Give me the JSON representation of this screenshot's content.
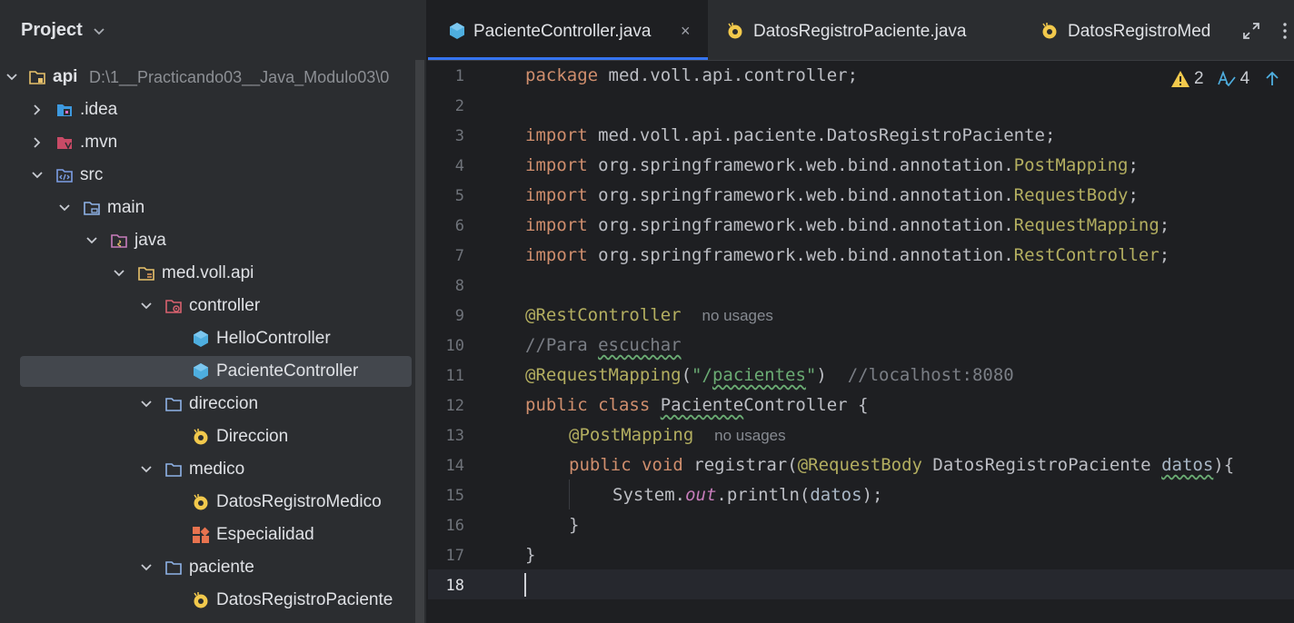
{
  "project_panel": {
    "title": "Project",
    "tree": [
      {
        "label": "api",
        "path": "D:\\1__Practicando03__Java_Modulo03\\0"
      },
      {
        "label": ".idea"
      },
      {
        "label": ".mvn"
      },
      {
        "label": "src"
      },
      {
        "label": "main"
      },
      {
        "label": "java"
      },
      {
        "label": "med.voll.api"
      },
      {
        "label": "controller"
      },
      {
        "label": "HelloController"
      },
      {
        "label": "PacienteController"
      },
      {
        "label": "direccion"
      },
      {
        "label": "Direccion"
      },
      {
        "label": "medico"
      },
      {
        "label": "DatosRegistroMedico"
      },
      {
        "label": "Especialidad"
      },
      {
        "label": "paciente"
      },
      {
        "label": "DatosRegistroPaciente"
      }
    ]
  },
  "editor": {
    "tabs": [
      {
        "label": "PacienteController.java",
        "close": "×"
      },
      {
        "label": "DatosRegistroPaciente.java"
      },
      {
        "label": "DatosRegistroMed"
      }
    ],
    "inspections": {
      "warnings": "2",
      "typos": "4"
    },
    "line_numbers": [
      "1",
      "2",
      "3",
      "4",
      "5",
      "6",
      "7",
      "8",
      "9",
      "10",
      "11",
      "12",
      "13",
      "14",
      "15",
      "16",
      "17",
      "18"
    ],
    "code": {
      "l1_kw": "package",
      "l1_rest": " med.voll.api.controller;",
      "import_kw": "import",
      "l3_rest": " med.voll.api.paciente.DatosRegistroPaciente;",
      "pkg_annotation": " org.springframework.web.bind.annotation.",
      "l4_cls": "PostMapping",
      "l5_cls": "RequestBody",
      "l6_cls": "RequestMapping",
      "l7_cls": "RestController",
      "semicolon": ";",
      "l9_ann": "@RestController",
      "no_usages": "no usages",
      "l10_cmt_a": "//Para ",
      "l10_cmt_b": "escuchar",
      "l11_ann": "@RequestMapping",
      "l11_open": "(",
      "l11_str_a": "\"/",
      "l11_str_b": "pacientes",
      "l11_str_c": "\"",
      "l11_close": ")",
      "l11_cmt": "//localhost:8080",
      "l12_kw": "public class ",
      "l12_cls_a": "Paciente",
      "l12_cls_b": "Controller",
      "l12_rest": " {",
      "l13_ann": "@PostMapping",
      "l14_kw": "public void ",
      "l14_method": "registrar",
      "l14_open": "(",
      "l14_ann": "@RequestBody",
      "l14_type": " DatosRegistroPaciente ",
      "l14_param": "datos",
      "l14_close": "){",
      "l15_a": "System.",
      "l15_out": "out",
      "l15_b": ".println(",
      "l15_param": "datos",
      "l15_c": ");",
      "l16": "}",
      "l17": "}"
    }
  }
}
